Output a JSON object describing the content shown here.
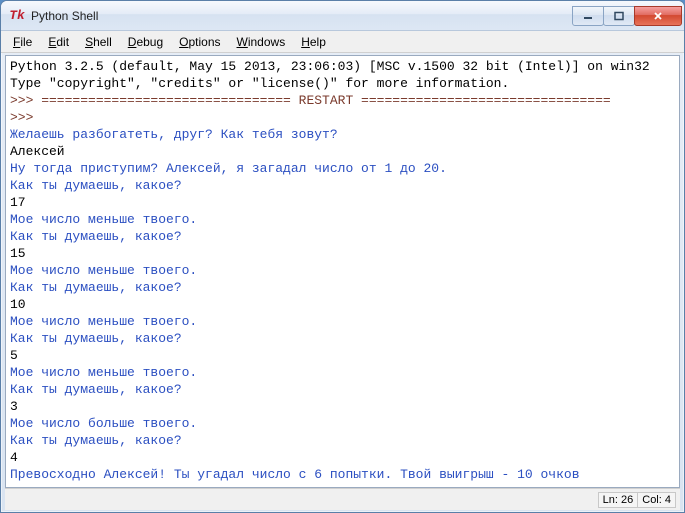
{
  "window": {
    "title": "Python Shell"
  },
  "menu": {
    "items": [
      {
        "label": "File",
        "acc": "F"
      },
      {
        "label": "Edit",
        "acc": "E"
      },
      {
        "label": "Shell",
        "acc": "S"
      },
      {
        "label": "Debug",
        "acc": "D"
      },
      {
        "label": "Options",
        "acc": "O"
      },
      {
        "label": "Windows",
        "acc": "W"
      },
      {
        "label": "Help",
        "acc": "H"
      }
    ]
  },
  "terminal": {
    "lines": [
      {
        "cls": "sys",
        "text": "Python 3.2.5 (default, May 15 2013, 23:06:03) [MSC v.1500 32 bit (Intel)] on win32"
      },
      {
        "cls": "sys",
        "text": "Type \"copyright\", \"credits\" or \"license()\" for more information."
      },
      {
        "cls": "prompt",
        "text": ">>> ================================ RESTART ================================"
      },
      {
        "cls": "prompt",
        "text": ">>> "
      },
      {
        "cls": "prog",
        "text": "Желаешь разбогатеть, друг? Как тебя зовут?"
      },
      {
        "cls": "user",
        "text": "Алексей"
      },
      {
        "cls": "prog",
        "text": "Ну тогда приступим? Алексей, я загадал число от 1 до 20."
      },
      {
        "cls": "prog",
        "text": "Как ты думаешь, какое?"
      },
      {
        "cls": "user",
        "text": "17"
      },
      {
        "cls": "prog",
        "text": "Мое число меньше твоего."
      },
      {
        "cls": "prog",
        "text": "Как ты думаешь, какое?"
      },
      {
        "cls": "user",
        "text": "15"
      },
      {
        "cls": "prog",
        "text": "Мое число меньше твоего."
      },
      {
        "cls": "prog",
        "text": "Как ты думаешь, какое?"
      },
      {
        "cls": "user",
        "text": "10"
      },
      {
        "cls": "prog",
        "text": "Мое число меньше твоего."
      },
      {
        "cls": "prog",
        "text": "Как ты думаешь, какое?"
      },
      {
        "cls": "user",
        "text": "5"
      },
      {
        "cls": "prog",
        "text": "Мое число меньше твоего."
      },
      {
        "cls": "prog",
        "text": "Как ты думаешь, какое?"
      },
      {
        "cls": "user",
        "text": "3"
      },
      {
        "cls": "prog",
        "text": "Мое число больше твоего."
      },
      {
        "cls": "prog",
        "text": "Как ты думаешь, какое?"
      },
      {
        "cls": "user",
        "text": "4"
      },
      {
        "cls": "prog",
        "text": "Превосходно Алексей! Ты угадал число с 6 попытки. Твой выигрыш - 10 очков"
      },
      {
        "cls": "prompt",
        "text": ">>> "
      }
    ]
  },
  "status": {
    "ln_label": "Ln:",
    "ln_value": "26",
    "col_label": "Col:",
    "col_value": "4"
  }
}
